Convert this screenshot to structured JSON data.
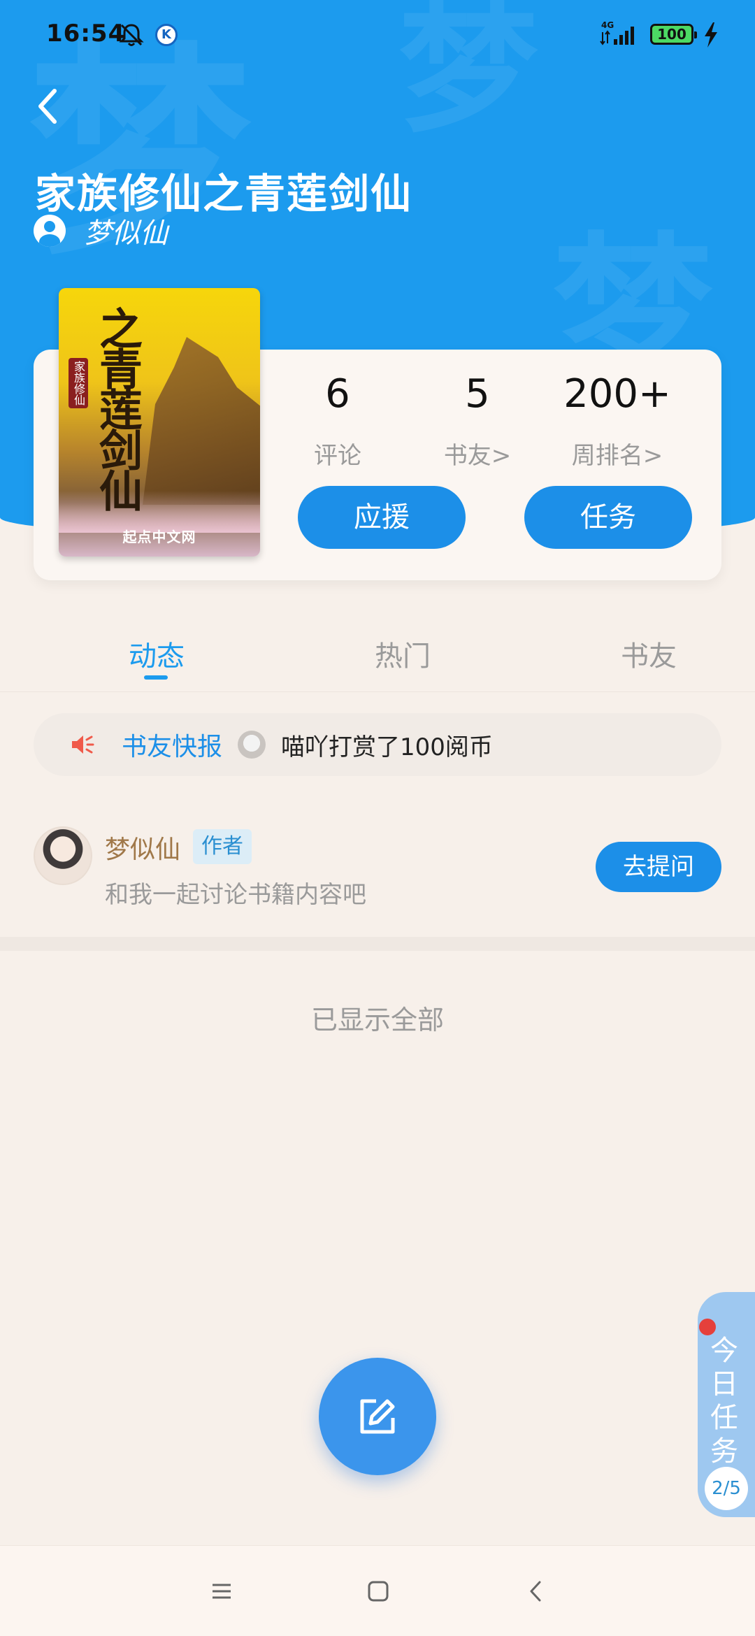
{
  "status_bar": {
    "time": "16:54",
    "battery": "100",
    "network": "4G"
  },
  "header": {
    "title": "家族修仙之青莲剑仙",
    "author": "梦似仙",
    "watermark": "梦"
  },
  "cover": {
    "title": "之青莲剑仙",
    "subtitle": "家族修仙",
    "publisher": "起点中文网"
  },
  "stats": [
    {
      "value": "6",
      "label": "评论"
    },
    {
      "value": "5",
      "label": "书友>"
    },
    {
      "value": "200+",
      "label": "周排名>"
    }
  ],
  "actions": {
    "support": "应援",
    "task": "任务"
  },
  "tabs": [
    {
      "label": "动态",
      "active": true
    },
    {
      "label": "热门",
      "active": false
    },
    {
      "label": "书友",
      "active": false
    }
  ],
  "news": {
    "label": "书友快报",
    "text": "喵吖打赏了100阅币"
  },
  "post": {
    "name": "梦似仙",
    "badge": "作者",
    "desc": "和我一起讨论书籍内容吧",
    "button": "去提问"
  },
  "footer_note": "已显示全部",
  "task_widget": {
    "label": "今日任务",
    "progress": "2/5"
  },
  "colors": {
    "brand_blue": "#1c9bee",
    "button_blue": "#1c8fe8",
    "background": "#f7f0ea",
    "author_gold": "#a07849"
  },
  "icons": [
    "bell-off-icon",
    "k-app-icon",
    "signal-icon",
    "battery-icon",
    "charging-icon",
    "back-icon",
    "user-icon",
    "speaker-icon",
    "edit-icon",
    "menu-icon",
    "home-icon",
    "nav-back-icon"
  ]
}
